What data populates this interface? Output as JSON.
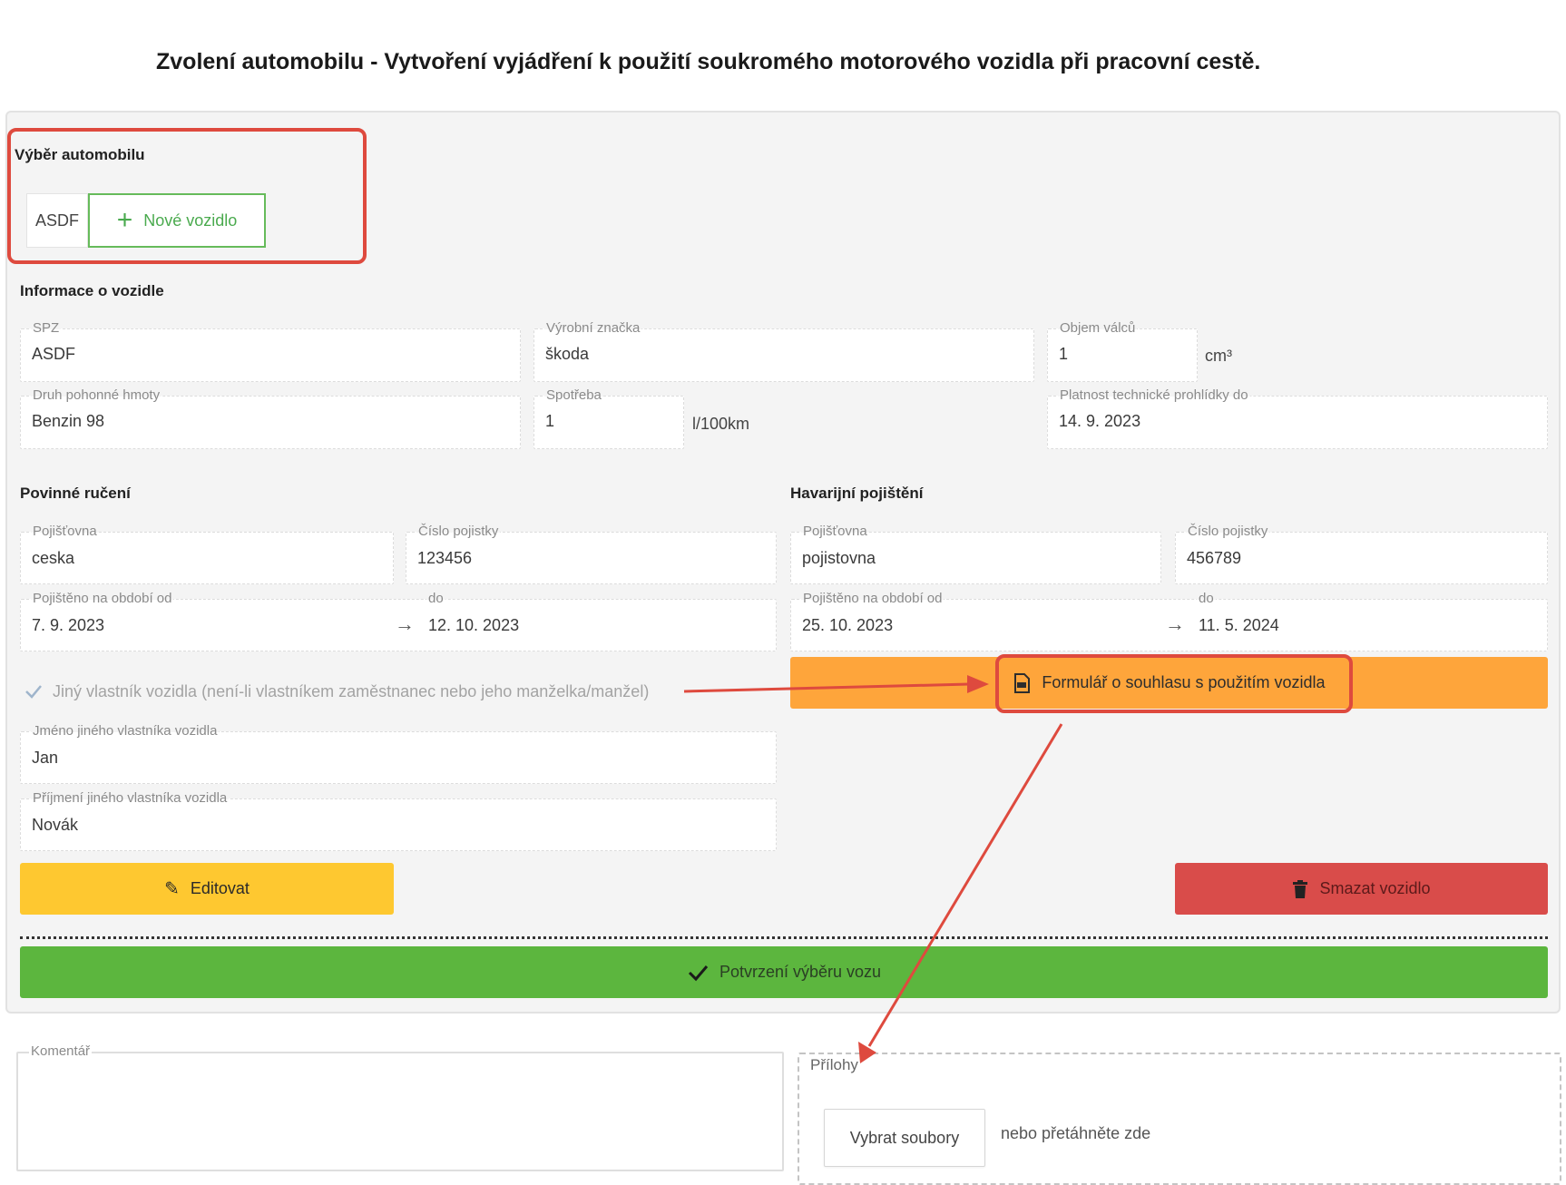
{
  "page_title": "Zvolení automobilu - Vytvoření vyjádření k použití soukromého motorového vozidla při pracovní cestě.",
  "car_selection": {
    "title": "Výběr automobilu",
    "selected_car": "ASDF",
    "new_car_label": "Nové vozidlo"
  },
  "vehicle_info": {
    "title": "Informace o vozidle",
    "spz": {
      "label": "SPZ",
      "value": "ASDF"
    },
    "brand": {
      "label": "Výrobní značka",
      "value": "škoda"
    },
    "engine_volume": {
      "label": "Objem válců",
      "value": "1",
      "unit": "cm³"
    },
    "fuel_type": {
      "label": "Druh pohonné hmoty",
      "value": "Benzin 98"
    },
    "consumption": {
      "label": "Spotřeba",
      "value": "1",
      "unit": "l/100km"
    },
    "inspection_valid": {
      "label": "Platnost technické prohlídky do",
      "value": "14. 9. 2023"
    }
  },
  "mandatory_insurance": {
    "title": "Povinné ručení",
    "insurer": {
      "label": "Pojišťovna",
      "value": "ceska"
    },
    "policy_number": {
      "label": "Číslo pojistky",
      "value": "123456"
    },
    "period_from": {
      "label": "Pojištěno na období od",
      "value": "7. 9. 2023"
    },
    "period_to": {
      "label": "do",
      "value": "12. 10. 2023"
    }
  },
  "accident_insurance": {
    "title": "Havarijní pojištění",
    "insurer": {
      "label": "Pojišťovna",
      "value": "pojistovna"
    },
    "policy_number": {
      "label": "Číslo pojistky",
      "value": "456789"
    },
    "period_from": {
      "label": "Pojištěno na období od",
      "value": "25. 10. 2023"
    },
    "period_to": {
      "label": "do",
      "value": "11. 5. 2024"
    }
  },
  "other_owner": {
    "checkbox_label": "Jiný vlastník vozidla (není-li vlastníkem zaměstnanec nebo jeho manželka/manžel)",
    "checked": true,
    "first_name": {
      "label": "Jméno jiného vlastníka vozidla",
      "value": "Jan"
    },
    "last_name": {
      "label": "Příjmení jiného vlastníka vozidla",
      "value": "Novák"
    }
  },
  "buttons": {
    "consent_form": "Formulář o souhlasu s použitím vozidla",
    "edit": "Editovat",
    "delete": "Smazat vozidlo",
    "confirm": "Potvrzení výběru vozu"
  },
  "comment": {
    "label": "Komentář",
    "value": ""
  },
  "attachments": {
    "label": "Přílohy",
    "choose_files": "Vybrat soubory",
    "drop_hint": "nebo přetáhněte zde"
  },
  "colors": {
    "accent_green": "#5cb63e",
    "warning_yellow": "#fec830",
    "orange": "#fea53b",
    "danger_red": "#d94c4a",
    "annotation_red": "#de4a3e"
  }
}
